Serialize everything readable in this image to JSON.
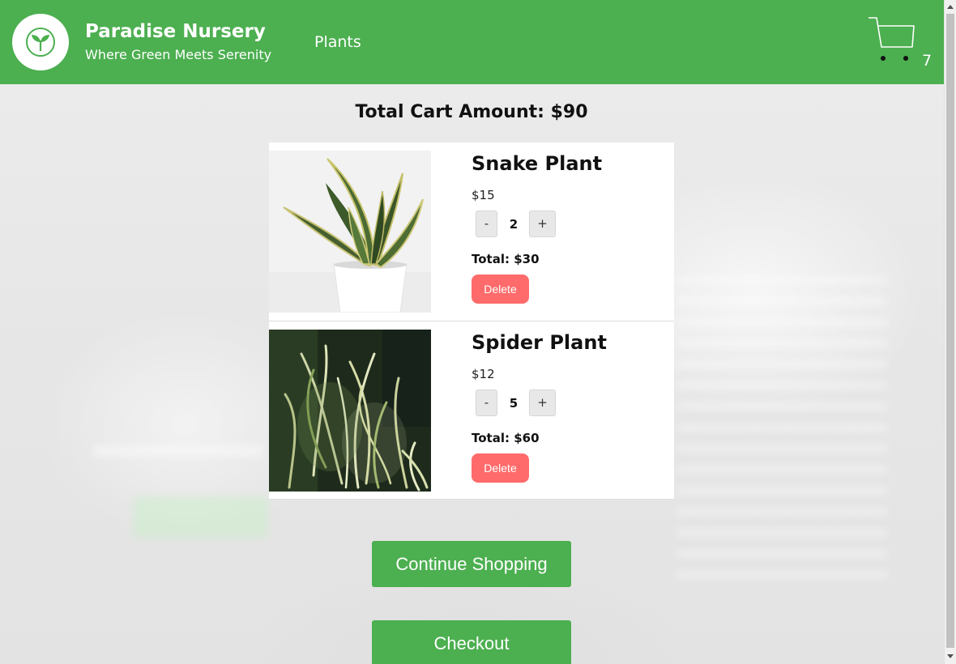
{
  "header": {
    "brand_title": "Paradise Nursery",
    "brand_tagline": "Where Green Meets Serenity",
    "nav_plants": "Plants",
    "cart_count": "7",
    "brand_color": "#4caf50"
  },
  "cart": {
    "total_heading": "Total Cart Amount: $90",
    "items": [
      {
        "name": "Snake Plant",
        "price": "$15",
        "quantity": "2",
        "minus_label": "-",
        "plus_label": "+",
        "subtotal": "Total: $30",
        "delete_label": "Delete",
        "image_icon": "snake-plant-image"
      },
      {
        "name": "Spider Plant",
        "price": "$12",
        "quantity": "5",
        "minus_label": "-",
        "plus_label": "+",
        "subtotal": "Total: $60",
        "delete_label": "Delete",
        "image_icon": "spider-plant-image"
      }
    ],
    "continue_label": "Continue Shopping",
    "checkout_label": "Checkout",
    "delete_color": "#ff6b6b"
  }
}
